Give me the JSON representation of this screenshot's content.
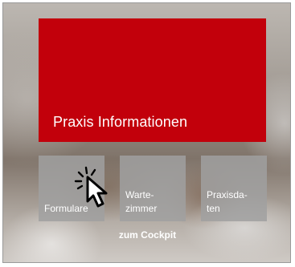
{
  "hero": {
    "title": "Praxis Informationen",
    "color": "#c2000b"
  },
  "tiles": [
    {
      "label": "Formulare"
    },
    {
      "label": "Warte-\nzimmer"
    },
    {
      "label": "Praxisda-\nten"
    }
  ],
  "footer_link": {
    "label": "zum Cockpit"
  },
  "cursor": {
    "icon": "pointer-hand-click-icon"
  }
}
